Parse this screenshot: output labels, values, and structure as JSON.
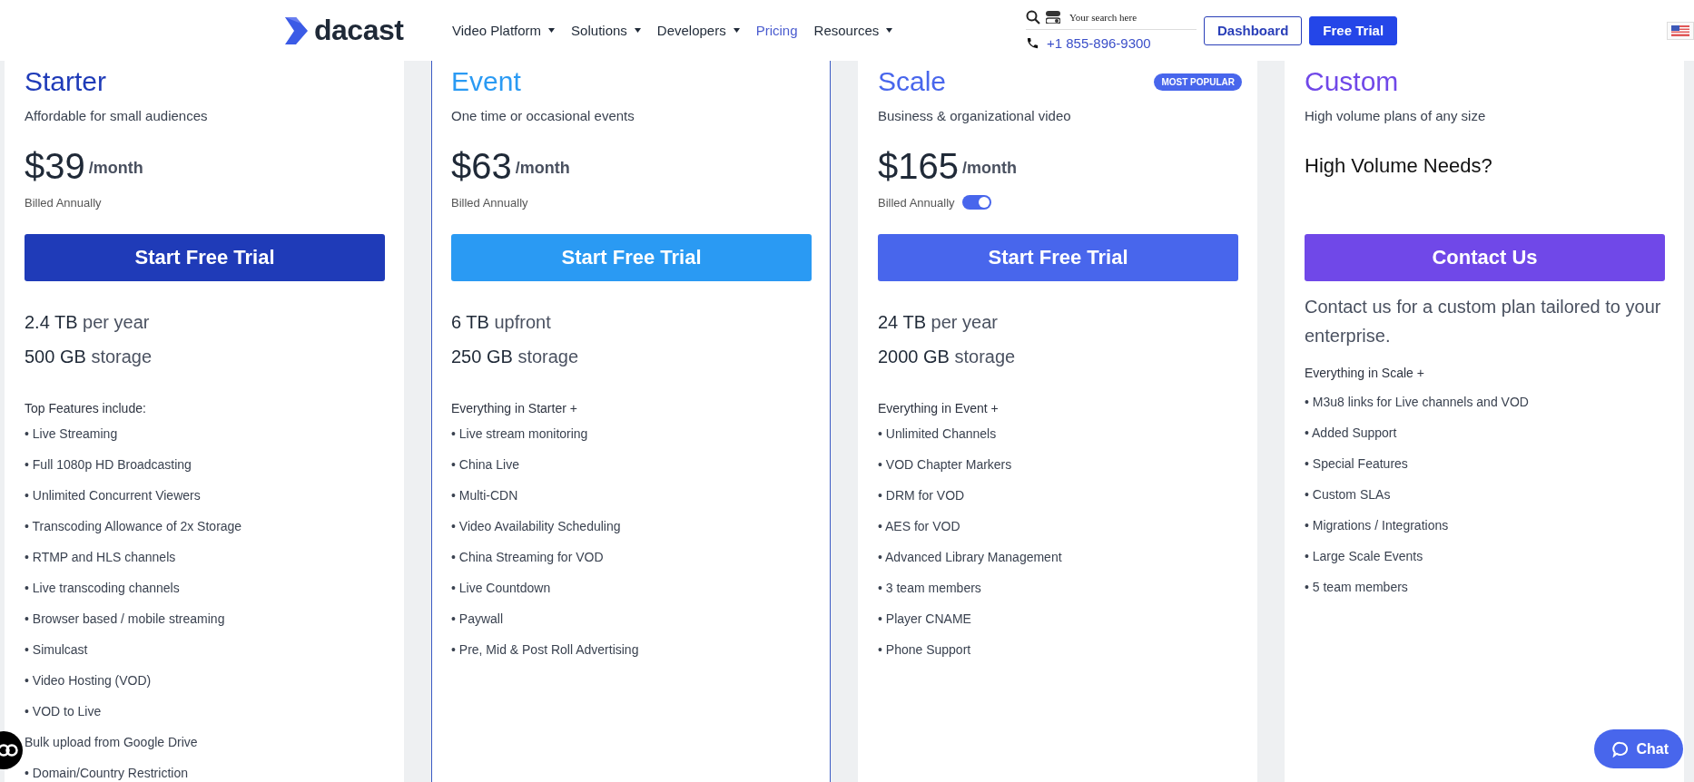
{
  "header": {
    "logo": "dacast",
    "nav": [
      {
        "label": "Video Platform",
        "dropdown": true,
        "selected": false
      },
      {
        "label": "Solutions",
        "dropdown": true,
        "selected": false
      },
      {
        "label": "Developers",
        "dropdown": true,
        "selected": false
      },
      {
        "label": "Pricing",
        "dropdown": false,
        "selected": true
      },
      {
        "label": "Resources",
        "dropdown": true,
        "selected": false
      }
    ],
    "search": {
      "placeholder": "Your search here"
    },
    "phone": "+1 855-896-9300",
    "buttons": [
      {
        "label": "Dashboard",
        "kind": "outline"
      },
      {
        "label": "Free Trial",
        "kind": "filled"
      }
    ]
  },
  "plans": [
    {
      "kind": "standard",
      "name": "Starter",
      "color": "#1f3bb8",
      "tagline": "Affordable for small audiences",
      "price": "$39",
      "period": "/month",
      "billing": "Billed Annually",
      "highlighted": false,
      "button": "Start Free Trial",
      "allowance": [
        "**2.4 TB** per year",
        "**500 GB** storage"
      ],
      "features_heading": "Top Features include:",
      "features": [
        "• Live Streaming",
        "• Full 1080p HD Broadcasting",
        "• Unlimited Concurrent Viewers",
        "• Transcoding Allowance of 2x Storage",
        "• RTMP and HLS channels",
        "• Live transcoding channels",
        "• Browser based / mobile streaming",
        "• Simulcast",
        "• Video Hosting (VOD)",
        "• VOD to Live",
        "Bulk upload from Google Drive",
        "• Domain/Country Restriction"
      ]
    },
    {
      "kind": "standard",
      "name": "Event",
      "color": "#2a9af3",
      "tagline": "One time or occasional events",
      "price": "$63",
      "period": "/month",
      "billing": "Billed Annually",
      "highlighted": true,
      "button": "Start Free Trial",
      "allowance": [
        "**6 TB** upfront",
        "**250 GB** storage"
      ],
      "features_heading": "Everything in Starter +",
      "features": [
        "• Live stream monitoring",
        "• China Live",
        "• Multi-CDN",
        "• Video Availability Scheduling",
        "• China Streaming for VOD",
        "• Live Countdown",
        "• Paywall",
        "• Pre, Mid & Post Roll Advertising"
      ]
    },
    {
      "kind": "standard",
      "name": "Scale",
      "color": "#4866ec",
      "badge": "MOST POPULAR",
      "tagline": "Business & organizational video",
      "price": "$165",
      "period": "/month",
      "billing": "Billed Annually",
      "billing_toggle": {
        "on": true
      },
      "highlighted": false,
      "button": "Start Free Trial",
      "allowance": [
        "**24 TB** per year",
        "**2000 GB** storage"
      ],
      "features_heading": "Everything in Event +",
      "features": [
        "• Unlimited Channels",
        "• VOD Chapter Markers",
        "• DRM for VOD",
        "• AES for VOD",
        "• Advanced Library Management",
        "• 3 team members",
        "• Player CNAME",
        "• Phone Support"
      ]
    },
    {
      "kind": "custom",
      "name": "Custom",
      "color": "#7048e8",
      "tagline": "High volume plans of any size",
      "headline": "High Volume Needs?",
      "highlighted": false,
      "button": "Contact Us",
      "description": "Contact us for a custom plan tailored to your enterprise.",
      "features_heading": "Everything in Scale +",
      "features": [
        "• M3u8 links for Live channels and VOD",
        "• Added Support",
        "• Special Features",
        "• Custom SLAs",
        "• Migrations / Integrations",
        "• Large Scale Events",
        "• 5 team members"
      ]
    }
  ],
  "chat": {
    "label": "Chat"
  }
}
